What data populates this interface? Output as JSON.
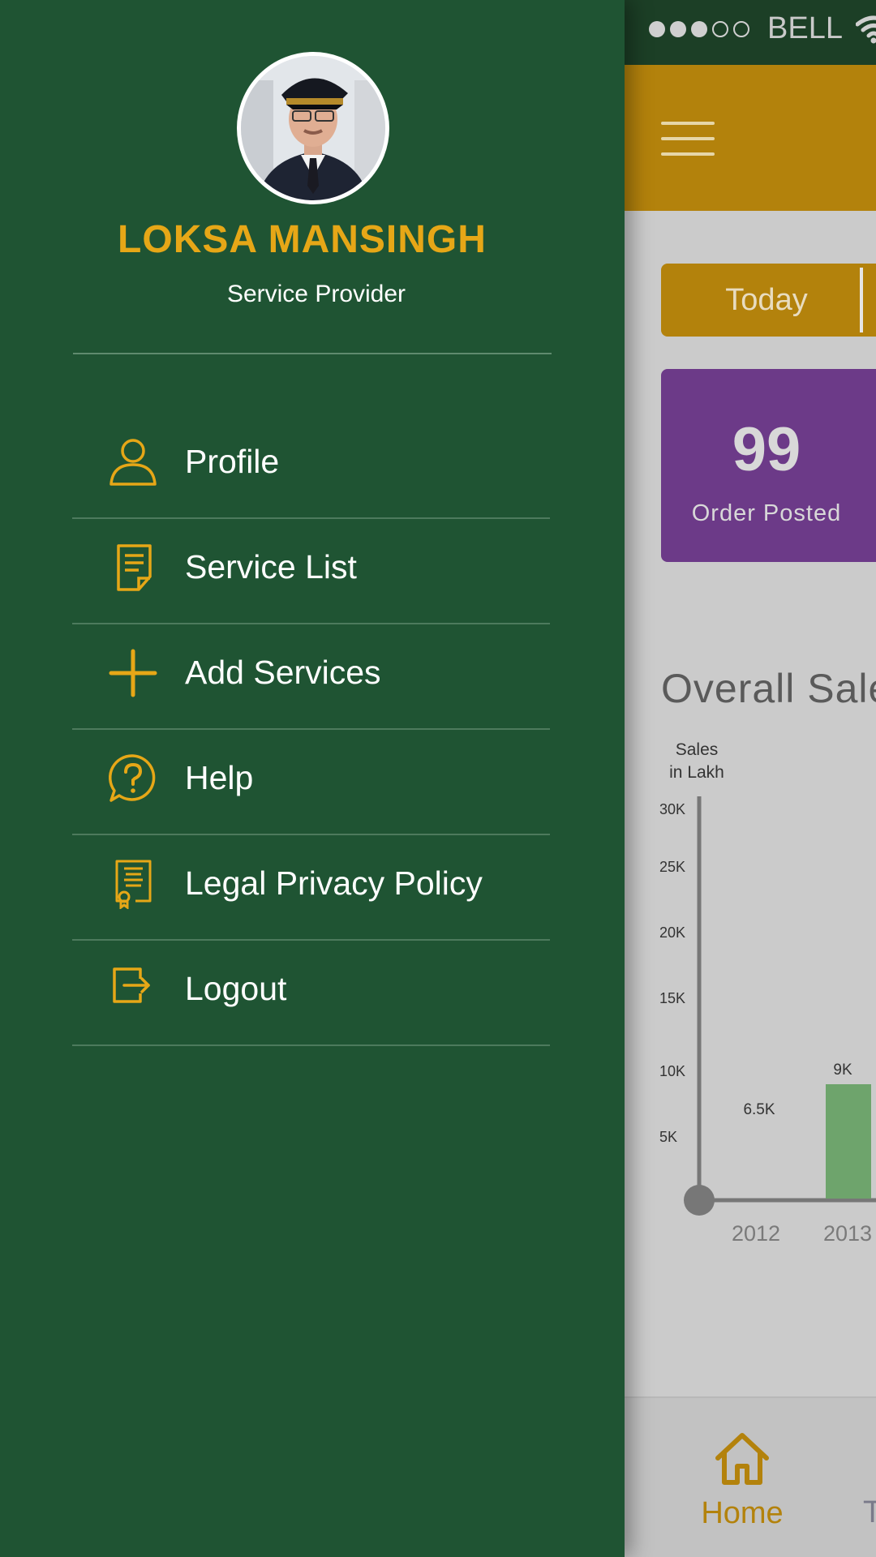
{
  "status_bar": {
    "carrier": "BELL",
    "signal_dots": [
      true,
      true,
      true,
      false,
      false
    ]
  },
  "tabs": {
    "active": "Today"
  },
  "order_card": {
    "count": "99",
    "label": "Order Posted"
  },
  "sales": {
    "title": "Overall Sale",
    "y_axis_label_line1": "Sales",
    "y_axis_label_line2": "in Lakh"
  },
  "chart_data": {
    "type": "bar",
    "title": "Overall Sale",
    "ylabel": "Sales in Lakh",
    "categories": [
      "2012",
      "2013"
    ],
    "values": [
      6500,
      9000
    ],
    "value_labels": [
      "6.5K",
      "9K"
    ],
    "y_ticks": [
      "5K",
      "10K",
      "15K",
      "20K",
      "25K",
      "30K"
    ],
    "ylim": [
      0,
      30000
    ],
    "grid": false,
    "colors": {
      "bar": "#6ea46c",
      "axis": "#777777"
    }
  },
  "bottom_nav": {
    "home_label": "Home",
    "next_partial": "T"
  },
  "drawer": {
    "user_name": "LOKSA MANSINGH",
    "user_role": "Service Provider",
    "menu": [
      {
        "label": "Profile",
        "icon": "user-icon"
      },
      {
        "label": "Service List",
        "icon": "document-list-icon"
      },
      {
        "label": "Add Services",
        "icon": "plus-icon"
      },
      {
        "label": "Help",
        "icon": "help-icon"
      },
      {
        "label": "Legal Privacy Policy",
        "icon": "certificate-icon"
      },
      {
        "label": "Logout",
        "icon": "logout-icon"
      }
    ]
  },
  "colors": {
    "drawer_bg": "#1f5433",
    "accent": "#e6a717",
    "header_bg": "#b3820c",
    "card_purple": "#6c3a88",
    "status_bar_bg": "#1c3f26"
  }
}
